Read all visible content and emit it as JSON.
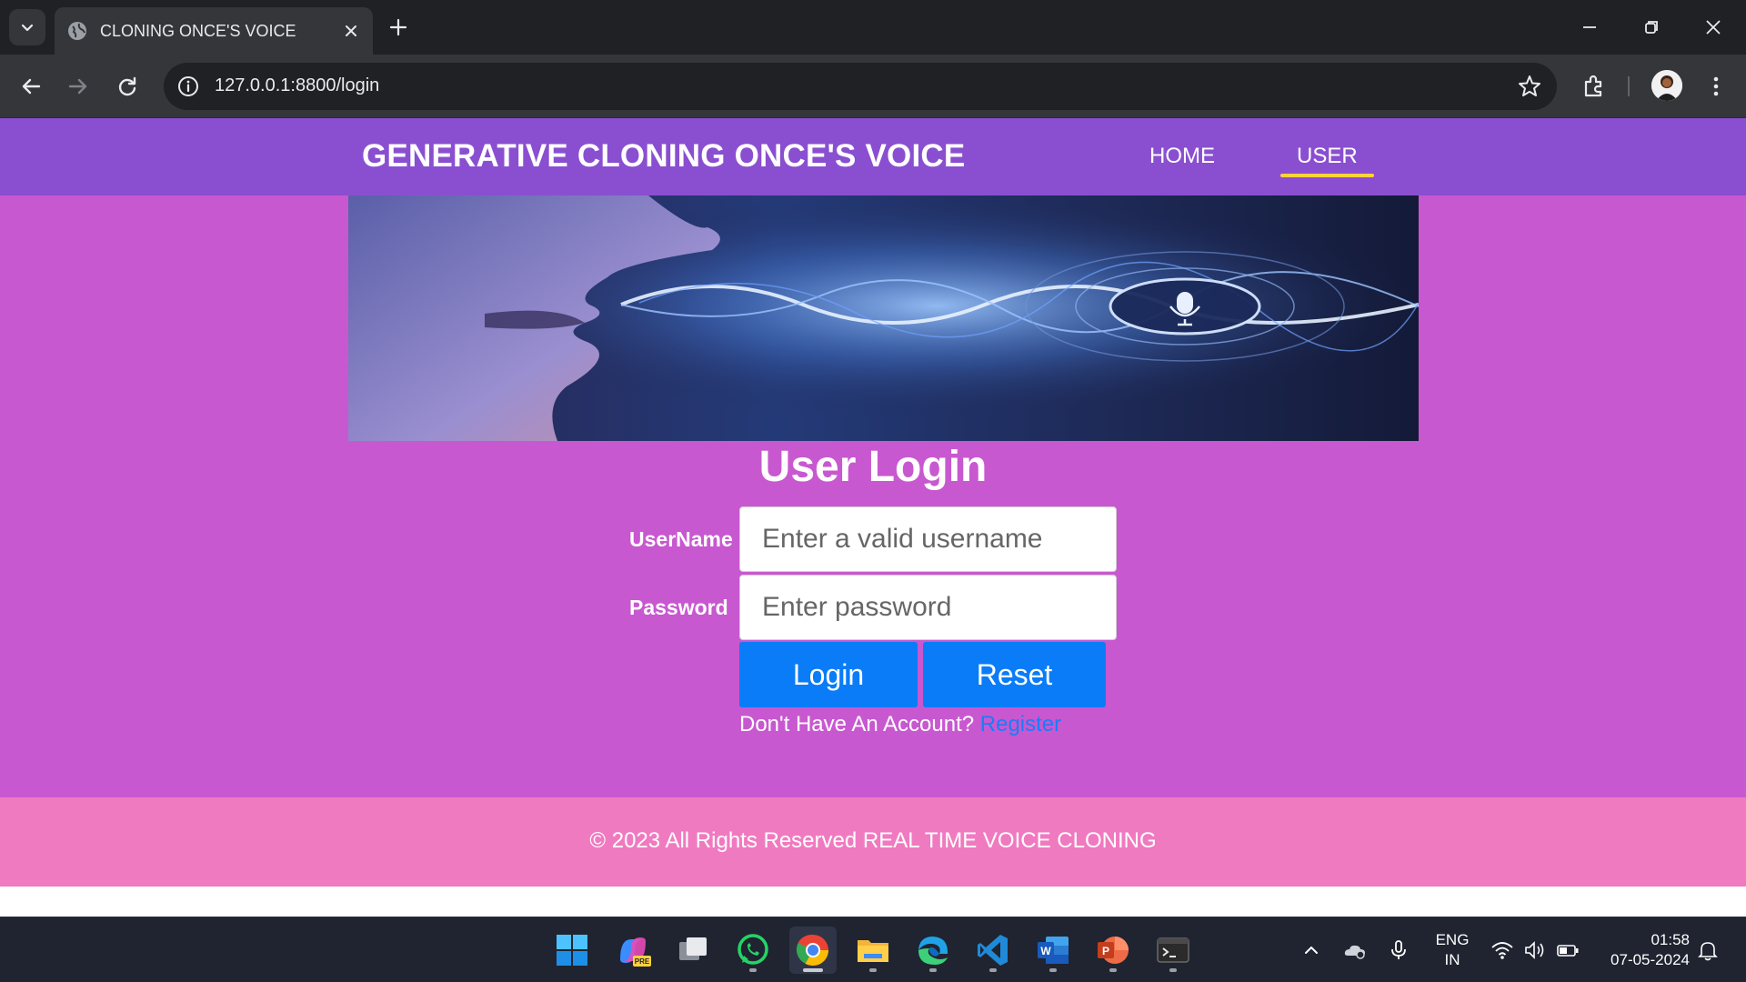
{
  "browser": {
    "tab_title": "CLONING ONCE'S VOICE",
    "url_host": "127.0.0.1",
    "url_rest": ":8800/login"
  },
  "site": {
    "brand": "GENERATIVE CLONING ONCE'S VOICE",
    "nav": [
      {
        "label": "HOME",
        "active": false
      },
      {
        "label": "USER",
        "active": true
      }
    ]
  },
  "login": {
    "title": "User Login",
    "username_label": "UserName",
    "username_placeholder": "Enter a valid username",
    "password_label": "Password",
    "password_placeholder": "Enter password",
    "login_button": "Login",
    "reset_button": "Reset",
    "no_account_text": "Don't Have An Account?",
    "register_link": "Register"
  },
  "footer": {
    "text": "© 2023 All Rights Reserved REAL TIME VOICE CLONING"
  },
  "taskbar": {
    "apps": [
      "start-icon",
      "copilot-icon",
      "task-view-icon",
      "whatsapp-icon",
      "chrome-icon",
      "file-explorer-icon",
      "edge-icon",
      "vscode-icon",
      "word-icon",
      "powerpoint-icon",
      "terminal-icon"
    ],
    "lang_line1": "ENG",
    "lang_line2": "IN",
    "time": "01:58",
    "date": "07-05-2024",
    "copilot_badge": "PRE"
  },
  "colors": {
    "navbar": "#8a4fd0",
    "page_bg": "#c858d0",
    "footer": "#f07ac0",
    "button": "#0a7cf8",
    "link": "#1a7cf7",
    "nav_underline": "#ffd23a"
  }
}
